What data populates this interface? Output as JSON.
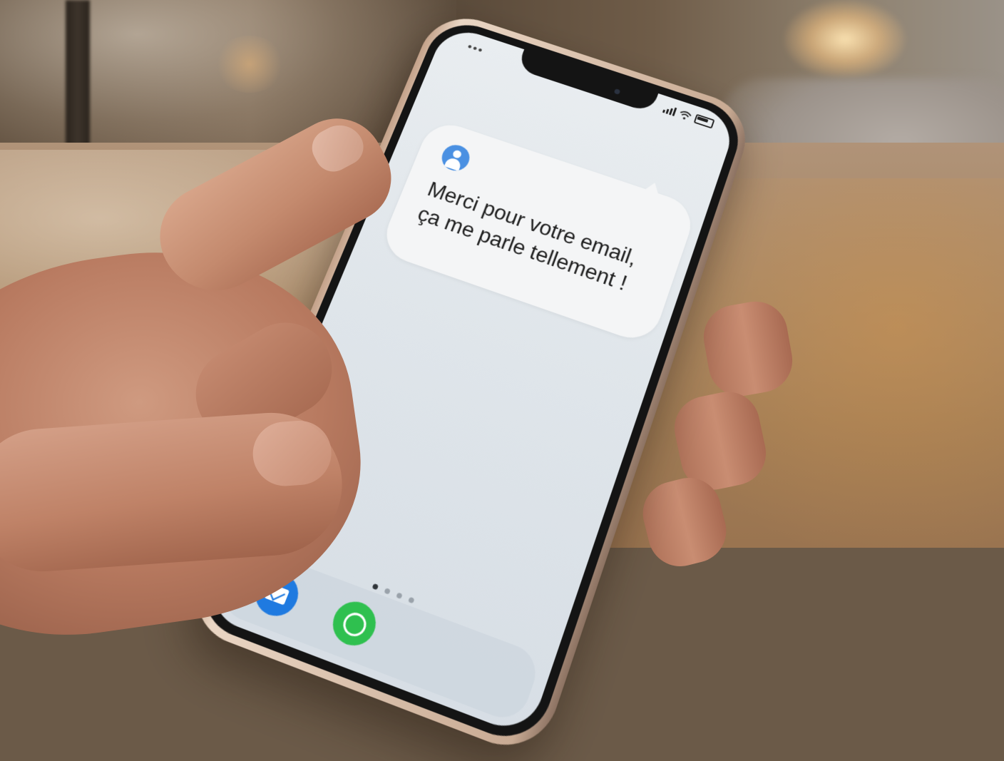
{
  "status_bar": {
    "left_indicator": "•••",
    "right_icons": [
      "cellular-signal-icon",
      "wifi-icon",
      "battery-icon"
    ]
  },
  "notification": {
    "avatar_icon": "person-avatar-icon",
    "lines": [
      "Merci pour votre email,",
      "ça me parle tellement !"
    ]
  },
  "page_indicator": {
    "count": 4,
    "active_index": 0
  },
  "dock": {
    "apps": [
      {
        "icon": "mail-icon",
        "color": "#1f7ae0"
      },
      {
        "icon": "whatsapp-icon",
        "color": "#2fc04f"
      }
    ]
  },
  "colors": {
    "avatar": "#4a90e2",
    "bubble": "#f4f5f6",
    "screen": "#e3e8ec"
  }
}
